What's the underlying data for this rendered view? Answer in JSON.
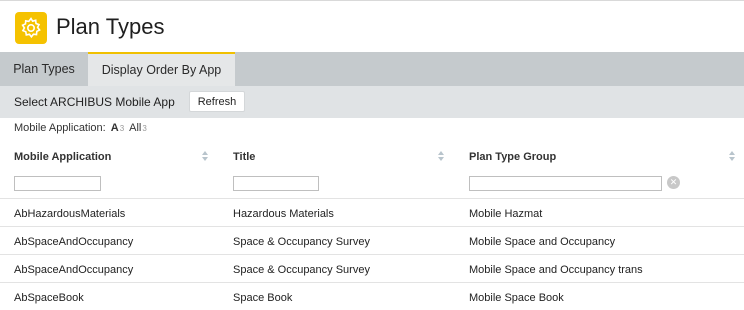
{
  "header": {
    "title": "Plan Types",
    "icon": "gear-icon",
    "icon_color": "#f5c200"
  },
  "tabs": [
    {
      "label": "Plan Types",
      "selected": false
    },
    {
      "label": "Display Order By App",
      "selected": true
    }
  ],
  "panel": {
    "title": "Select ARCHIBUS Mobile App",
    "refresh_label": "Refresh"
  },
  "index": {
    "label": "Mobile Application:",
    "items": [
      {
        "label": "A",
        "count": "3"
      },
      {
        "label": "All",
        "count": "3"
      }
    ]
  },
  "columns": [
    "Mobile Application",
    "Title",
    "Plan Type Group"
  ],
  "filters": [
    "",
    "",
    ""
  ],
  "rows": [
    [
      "AbHazardousMaterials",
      "Hazardous Materials",
      "Mobile Hazmat"
    ],
    [
      "AbSpaceAndOccupancy",
      "Space & Occupancy Survey",
      "Mobile Space and Occupancy"
    ],
    [
      "AbSpaceAndOccupancy",
      "Space & Occupancy Survey",
      "Mobile Space and Occupancy trans"
    ],
    [
      "AbSpaceBook",
      "Space Book",
      "Mobile Space Book"
    ]
  ]
}
